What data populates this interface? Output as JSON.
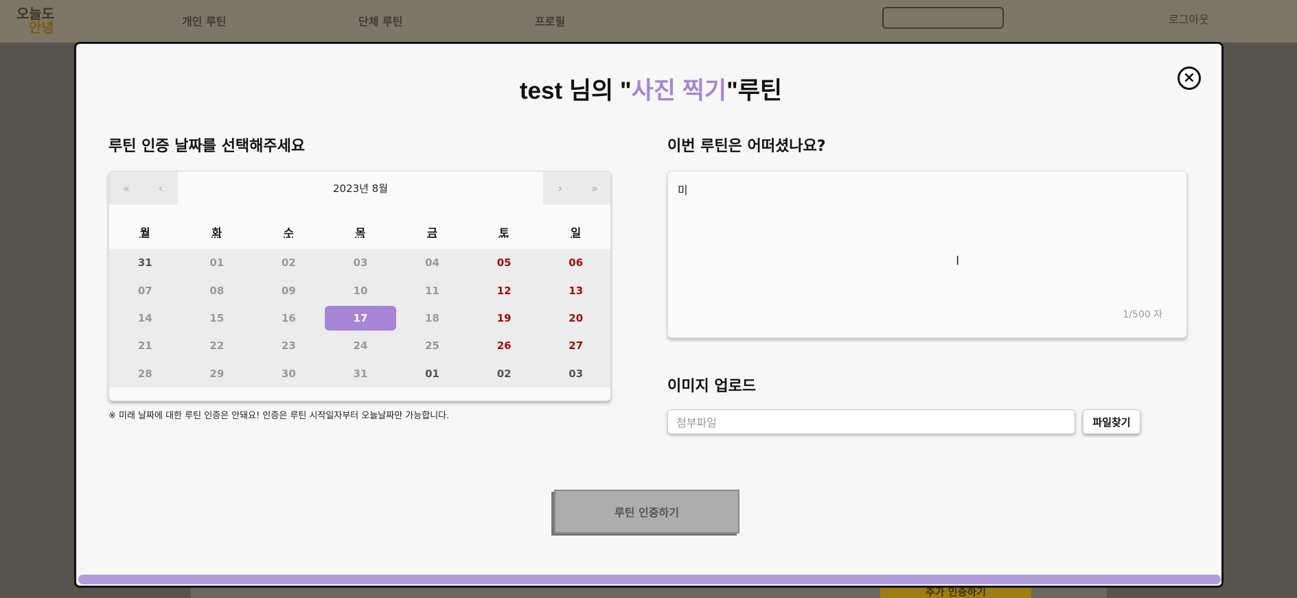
{
  "nav": {
    "logo_line1": "오늘도",
    "logo_line2": "안녕",
    "links": [
      "개인 루틴",
      "단체 루틴",
      "프로필"
    ],
    "logout": "로그아웃"
  },
  "background": {
    "add_button": "추가 인증하기"
  },
  "modal": {
    "title_prefix": "test 님의 \"",
    "title_routine": "사진 찍기",
    "title_suffix": "\"루틴",
    "close_icon": "close-icon",
    "date_section_title": "루틴 인증 날짜를 선택해주세요",
    "calendar": {
      "prev_year": "«",
      "prev_month": "‹",
      "month_label": "2023년 8월",
      "next_month": "›",
      "next_year": "»",
      "weekdays": [
        "월",
        "화",
        "수",
        "목",
        "금",
        "토",
        "일"
      ],
      "days": [
        "31",
        "01",
        "02",
        "03",
        "04",
        "05",
        "06",
        "07",
        "08",
        "09",
        "10",
        "11",
        "12",
        "13",
        "14",
        "15",
        "16",
        "17",
        "18",
        "19",
        "20",
        "21",
        "22",
        "23",
        "24",
        "25",
        "26",
        "27",
        "28",
        "29",
        "30",
        "31",
        "01",
        "02",
        "03"
      ],
      "selected_day": "17"
    },
    "note": "※ 미래 날짜에 대한 루틴 인증은 안돼요! 인증은 루틴 시작일자부터 오늘날짜만 가능합니다.",
    "review_section_title": "이번 루틴은 어떠셨나요?",
    "review_value": "미",
    "char_count": "1/500 자",
    "upload_section_title": "이미지 업로드",
    "file_placeholder": "첨부파일",
    "file_button": "파일찾기",
    "submit_button": "루틴 인증하기",
    "accent_color": "#a685d6",
    "weekend_color": "#a10d0d"
  }
}
